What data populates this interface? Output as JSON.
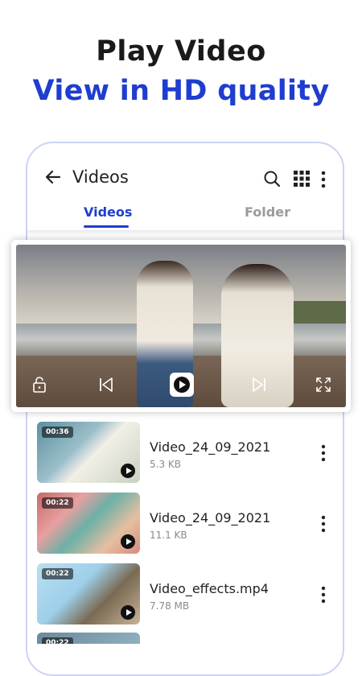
{
  "promo": {
    "title": "Play Video",
    "subtitle": "View in HD quality"
  },
  "app_bar": {
    "title": "Videos",
    "icons": [
      "back-arrow-icon",
      "search-icon",
      "grid-view-icon",
      "more-vert-icon"
    ]
  },
  "tabs": [
    {
      "label": "Videos",
      "active": true
    },
    {
      "label": "Folder",
      "active": false
    }
  ],
  "player": {
    "controls": [
      "lock-icon",
      "skip-previous-icon",
      "play-icon",
      "skip-next-icon",
      "fullscreen-icon"
    ]
  },
  "videos": [
    {
      "name": "Video_24_09_2021",
      "size": "5.3 KB",
      "duration": "00:36"
    },
    {
      "name": "Video_24_09_2021",
      "size": "11.1 KB",
      "duration": "00:22"
    },
    {
      "name": "Video_effects.mp4",
      "size": "7.78 MB",
      "duration": "00:22"
    },
    {
      "name": "",
      "size": "",
      "duration": "00:22"
    }
  ],
  "colors": {
    "accent": "#1f3dcf",
    "frame_border": "#cbd3f3",
    "muted_text": "#8a8a8a"
  }
}
